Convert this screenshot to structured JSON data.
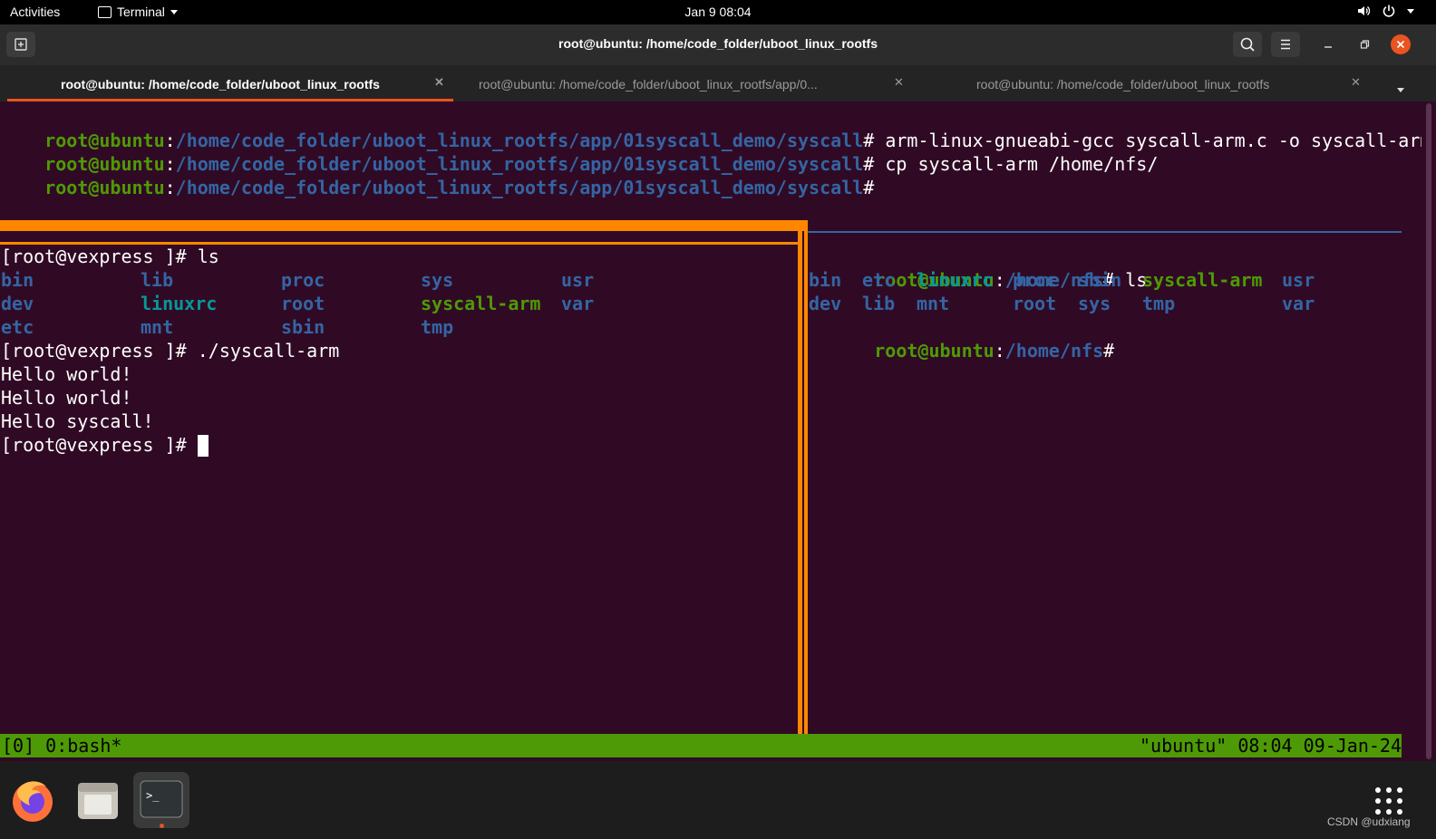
{
  "topbar": {
    "activities": "Activities",
    "app_menu": "Terminal",
    "clock": "Jan 9  08:04"
  },
  "window": {
    "title": "root@ubuntu: /home/code_folder/uboot_linux_rootfs"
  },
  "tabs": [
    {
      "label": "root@ubuntu: /home/code_folder/uboot_linux_rootfs",
      "active": true
    },
    {
      "label": "root@ubuntu: /home/code_folder/uboot_linux_rootfs/app/0...",
      "active": false
    },
    {
      "label": "root@ubuntu: /home/code_folder/uboot_linux_rootfs",
      "active": false
    }
  ],
  "terminal": {
    "top_lines": [
      {
        "user": "root@ubuntu",
        "path": "/home/code_folder/uboot_linux_rootfs/app/01syscall_demo/syscall",
        "cmd": "# arm-linux-gnueabi-gcc syscall-arm.c -o syscall-arm"
      },
      {
        "user": "root@ubuntu",
        "path": "/home/code_folder/uboot_linux_rootfs/app/01syscall_demo/syscall",
        "cmd": "# cp syscall-arm /home/nfs/"
      },
      {
        "user": "root@ubuntu",
        "path": "/home/code_folder/uboot_linux_rootfs/app/01syscall_demo/syscall",
        "cmd": "#"
      }
    ],
    "left_pane": {
      "prompt_ls": "[root@vexpress ]# ls",
      "ls_rows": [
        [
          "bin",
          "lib",
          "proc",
          "sys",
          "usr"
        ],
        [
          "dev",
          "linuxrc",
          "root",
          "syscall-arm",
          "var"
        ],
        [
          "etc",
          "mnt",
          "sbin",
          "tmp",
          ""
        ]
      ],
      "prompt_run": "[root@vexpress ]# ./syscall-arm",
      "output": [
        "Hello world!",
        "Hello world!",
        "Hello syscall!"
      ],
      "prompt_final": "[root@vexpress ]# "
    },
    "right_pane": {
      "prompt_user": "root@ubuntu",
      "prompt_path": "/home/nfs",
      "prompt_cmd": "# ls",
      "ls_rows": [
        [
          "bin",
          "etc",
          "linuxrc",
          "proc",
          "sbin",
          "syscall-arm",
          "usr"
        ],
        [
          "dev",
          "lib",
          "mnt",
          "root",
          "sys",
          "tmp",
          "var"
        ]
      ],
      "final_user": "root@ubuntu",
      "final_path": "/home/nfs",
      "final_cmd": "#"
    },
    "status_left": "[0] 0:bash*",
    "status_right": "\"ubuntu\" 08:04 09-Jan-24"
  },
  "dock": {
    "apps": [
      "firefox-icon",
      "files-icon",
      "terminal-icon"
    ]
  },
  "watermark": "CSDN @udxiang",
  "colors": {
    "accent": "#e95420",
    "tmux_pane_active": "#ff8700",
    "tmux_status": "#4e9a06",
    "prompt_green": "#4e9a06",
    "path_blue": "#3465a4",
    "exec_green": "#4e9a06",
    "link_cyan": "#06989a",
    "terminal_bg": "#300a24"
  }
}
